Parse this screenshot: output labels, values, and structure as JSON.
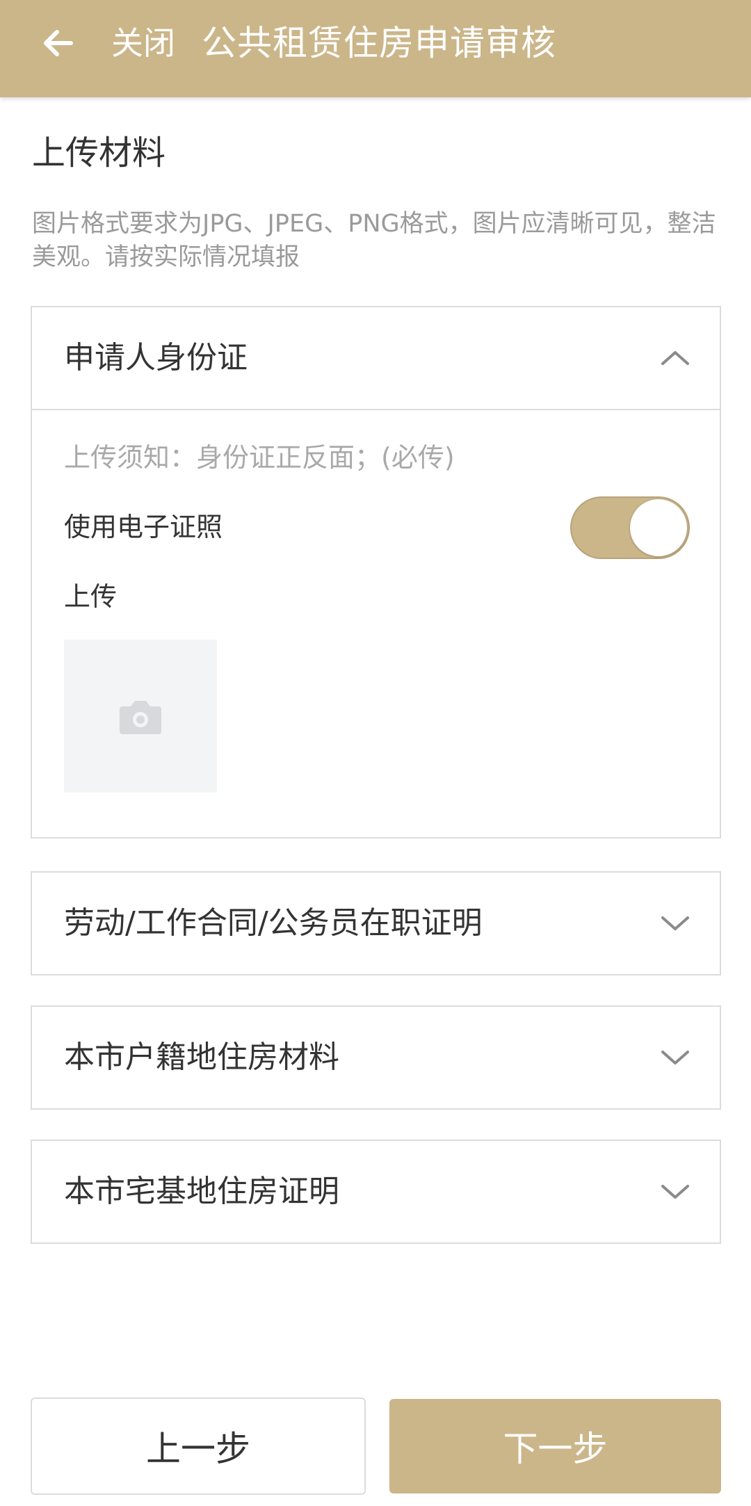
{
  "header": {
    "close_label": "关闭",
    "title": "公共租赁住房申请审核"
  },
  "main": {
    "section_title": "上传材料",
    "hint": "图片格式要求为JPG、JPEG、PNG格式，图片应清晰可见，整洁美观。请按实际情况填报"
  },
  "panels": [
    {
      "title": "申请人身份证",
      "expanded": true,
      "notice": "上传须知：身份证正反面；(必传)",
      "e_cert_label": "使用电子证照",
      "e_cert_enabled": true,
      "upload_label": "上传"
    },
    {
      "title": "劳动/工作合同/公务员在职证明",
      "expanded": false
    },
    {
      "title": "本市户籍地住房材料",
      "expanded": false
    },
    {
      "title": "本市宅基地住房证明",
      "expanded": false
    }
  ],
  "footer": {
    "prev_label": "上一步",
    "next_label": "下一步"
  },
  "colors": {
    "accent": "#cbb68a",
    "border": "#dcdcdc",
    "text": "#333333",
    "muted": "#9a9a9a"
  },
  "icons": {
    "back": "arrow-left-icon",
    "expanded": "chevron-up-icon",
    "collapsed": "chevron-down-icon",
    "upload": "camera-icon"
  }
}
